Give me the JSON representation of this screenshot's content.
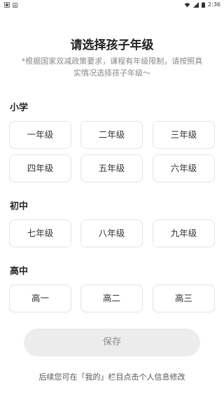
{
  "status_bar": {
    "left_icons": [
      "notification-icon",
      "a-icon"
    ],
    "time": "2:36",
    "right_icons": [
      "wifi-icon",
      "signal-icon",
      "battery-icon"
    ]
  },
  "title": "请选择孩子年级",
  "subtitle": "*根据国家双减政策要求，课程有年级限制，请按照真实情况选择孩子年级～",
  "sections": [
    {
      "label": "小学",
      "grades": [
        "一年级",
        "二年级",
        "三年级",
        "四年级",
        "五年级",
        "六年级"
      ]
    },
    {
      "label": "初中",
      "grades": [
        "七年级",
        "八年级",
        "九年级"
      ]
    },
    {
      "label": "高中",
      "grades": [
        "高一",
        "高二",
        "高三"
      ]
    }
  ],
  "save_label": "保存",
  "footer_note": "后续您可在「我的」栏目点击个人信息修改"
}
